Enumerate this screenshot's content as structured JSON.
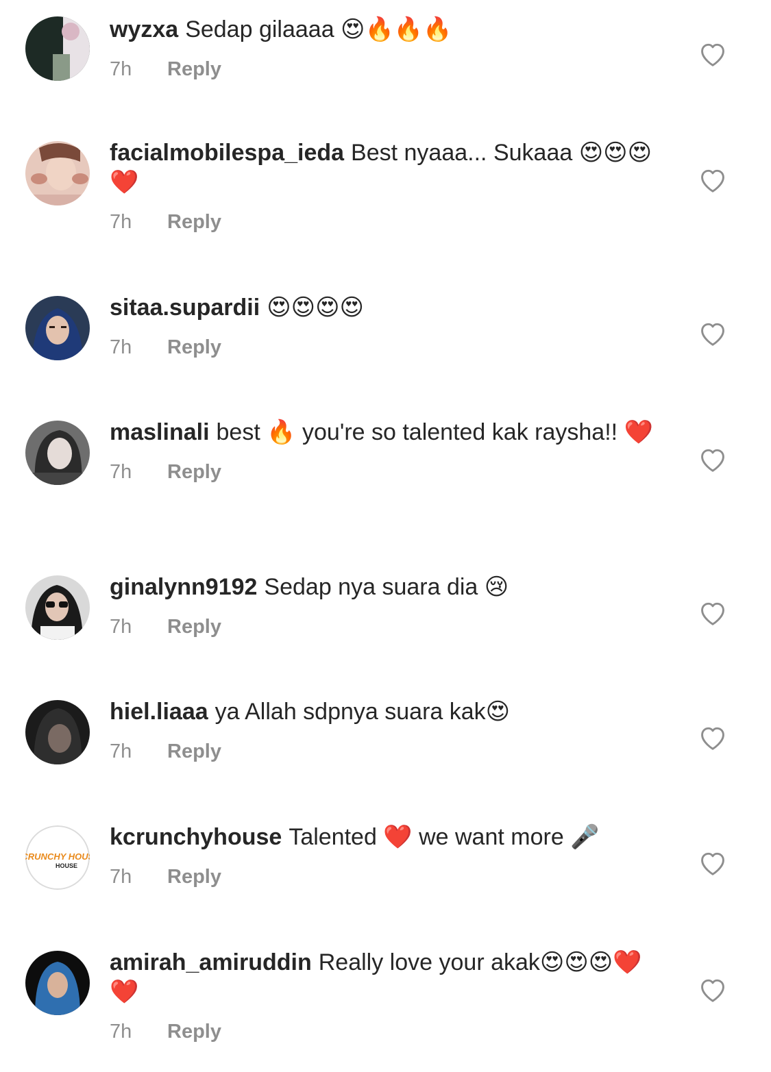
{
  "comments": [
    {
      "username": "wyzxa",
      "text": "Sedap gilaaaa 😍🔥🔥🔥",
      "time": "7h",
      "reply_label": "Reply",
      "avatar": "avatar-dark-photo"
    },
    {
      "username": "facialmobilespa_ieda",
      "text": "Best nyaaa... Sukaaa 😍😍😍❤️",
      "time": "7h",
      "reply_label": "Reply",
      "avatar": "avatar-spa-photo"
    },
    {
      "username": "sitaa.supardii",
      "text": "😍😍😍😍",
      "time": "7h",
      "reply_label": "Reply",
      "avatar": "avatar-hijab-photo"
    },
    {
      "username": "maslinali",
      "text": "best 🔥 you're so talented kak raysha!! ❤️",
      "time": "7h",
      "reply_label": "Reply",
      "avatar": "avatar-gray-photo"
    },
    {
      "username": "ginalynn9192",
      "text": "Sedap nya suara dia 😢",
      "time": "7h",
      "reply_label": "Reply",
      "avatar": "avatar-sunglasses-photo"
    },
    {
      "username": "hiel.liaaa",
      "text": "ya Allah sdpnya suara kak😍",
      "time": "7h",
      "reply_label": "Reply",
      "avatar": "avatar-dark-hood-photo"
    },
    {
      "username": "kcrunchyhouse",
      "text": "Talented ❤️ we want more 🎤",
      "time": "7h",
      "reply_label": "Reply",
      "avatar": "avatar-logo",
      "avatar_logo_text": "KCRUNCHY HOUSE"
    },
    {
      "username": "amirah_amiruddin",
      "text": "Really love your akak😍😍😍❤️❤️",
      "time": "7h",
      "reply_label": "Reply",
      "avatar": "avatar-blue-hijab-photo"
    }
  ],
  "icons": {
    "like": "heart-outline-icon"
  },
  "colors": {
    "text": "#262626",
    "meta": "#8e8e8e",
    "background": "#ffffff"
  }
}
